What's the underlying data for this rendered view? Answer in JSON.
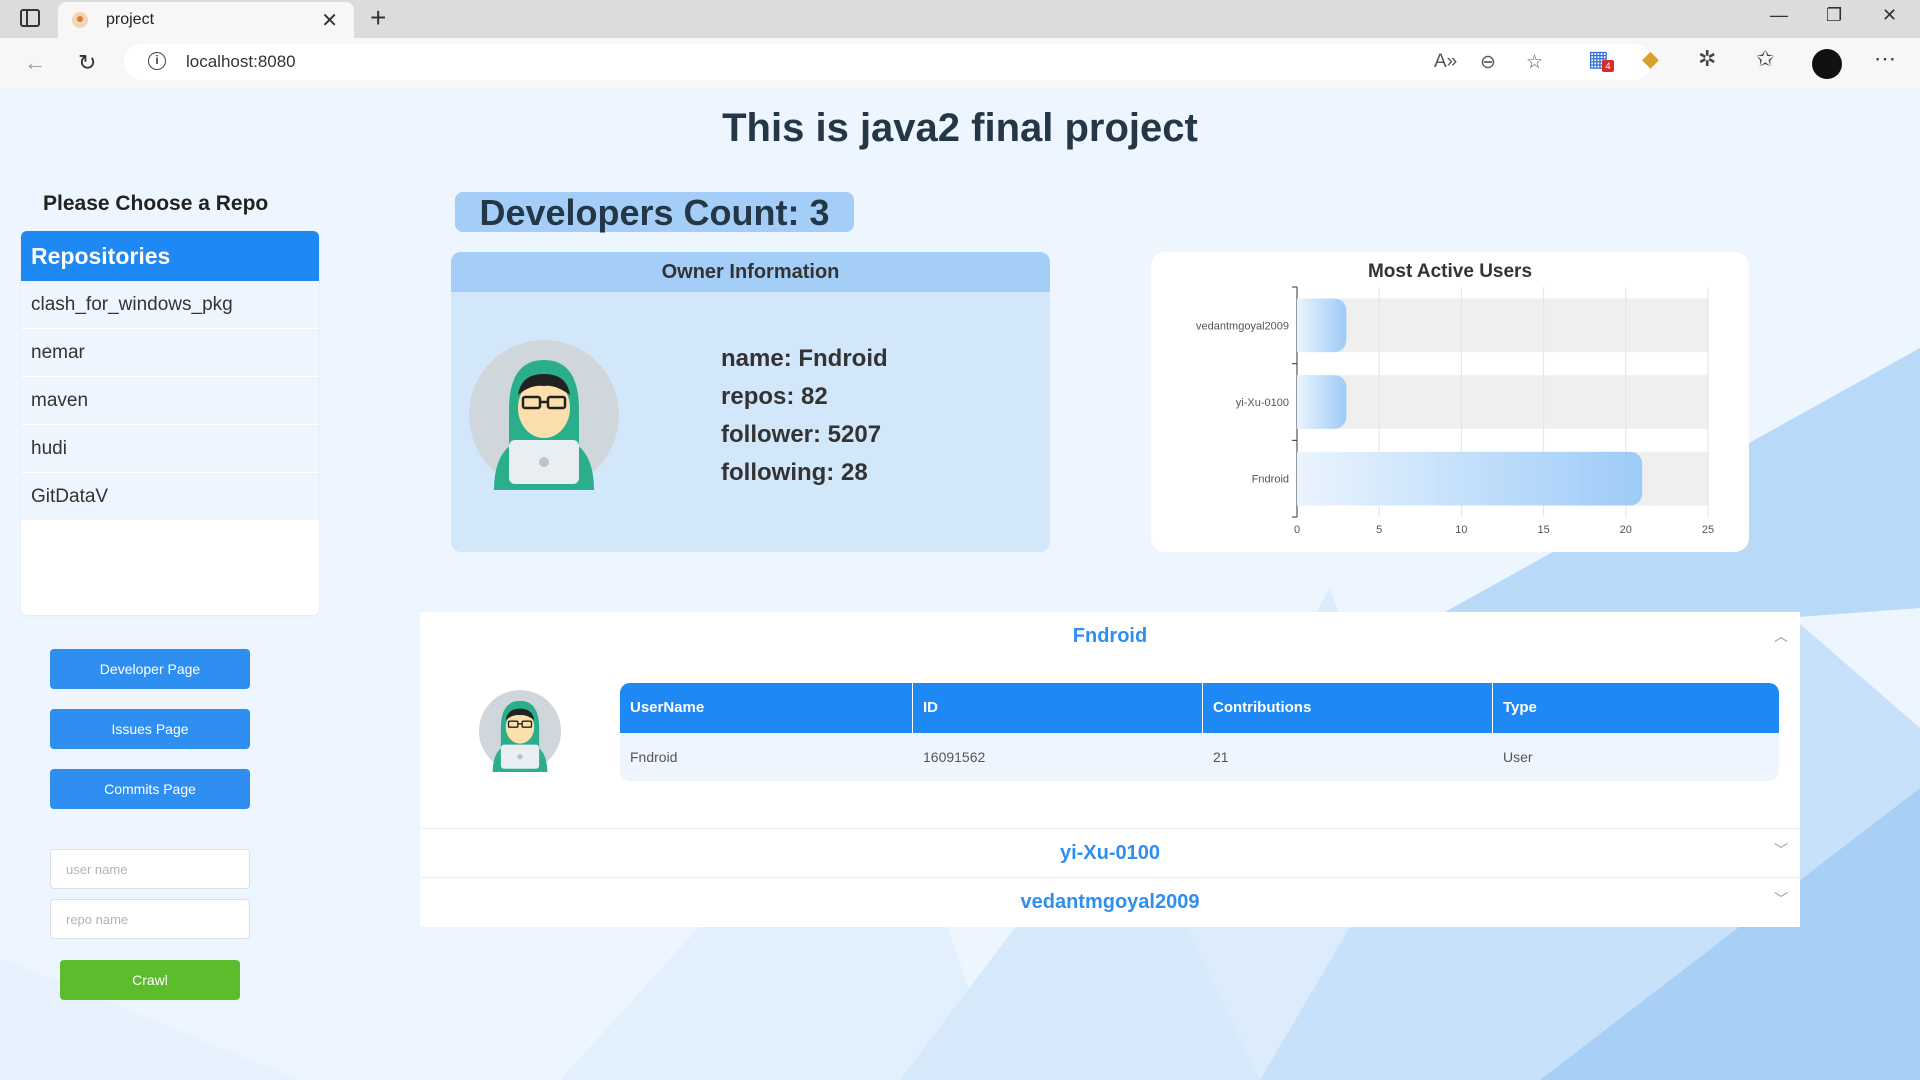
{
  "browser": {
    "tab_title": "project",
    "url": "localhost:8080",
    "extension_badge": "4"
  },
  "page": {
    "title": "This is java2 final project"
  },
  "sidebar": {
    "choose_label": "Please Choose a Repo",
    "repo_header": "Repositories",
    "repos": [
      "clash_for_windows_pkg",
      "nemar",
      "maven",
      "hudi",
      "GitDataV"
    ],
    "buttons": {
      "developer": "Developer Page",
      "issues": "Issues Page",
      "commits": "Commits Page"
    },
    "user_placeholder": "user name",
    "repo_placeholder": "repo name",
    "crawl_label": "Crawl"
  },
  "developers": {
    "count_text": "Developers Count: 3"
  },
  "owner": {
    "header": "Owner Information",
    "name": "name: Fndroid",
    "repos": "repos: 82",
    "follower": "follower: 5207",
    "following": "following: 28"
  },
  "chart_data": {
    "type": "bar",
    "orientation": "horizontal",
    "title": "Most Active Users",
    "categories": [
      "vedantmgoyal2009",
      "yi-Xu-0100",
      "Fndroid"
    ],
    "values": [
      3,
      3,
      21
    ],
    "xlim": [
      0,
      25
    ],
    "xticks": [
      0,
      5,
      10,
      15,
      20,
      25
    ],
    "grid": true,
    "colors": {
      "bar_start": "#eaf4fe",
      "bar_end": "#9dcbf8",
      "track": "#efefef"
    }
  },
  "accordion": {
    "items": [
      {
        "title": "Fndroid",
        "expanded": true
      },
      {
        "title": "yi-Xu-0100",
        "expanded": false
      },
      {
        "title": "vedantmgoyal2009",
        "expanded": false
      }
    ],
    "table": {
      "headers": [
        "UserName",
        "ID",
        "Contributions",
        "Type"
      ],
      "row": [
        "Fndroid",
        "16091562",
        "21",
        "User"
      ]
    }
  },
  "colors": {
    "primary": "#1e88f5",
    "success": "#5bbd2b",
    "accent_light": "#a4cef8",
    "title": "#243746"
  }
}
